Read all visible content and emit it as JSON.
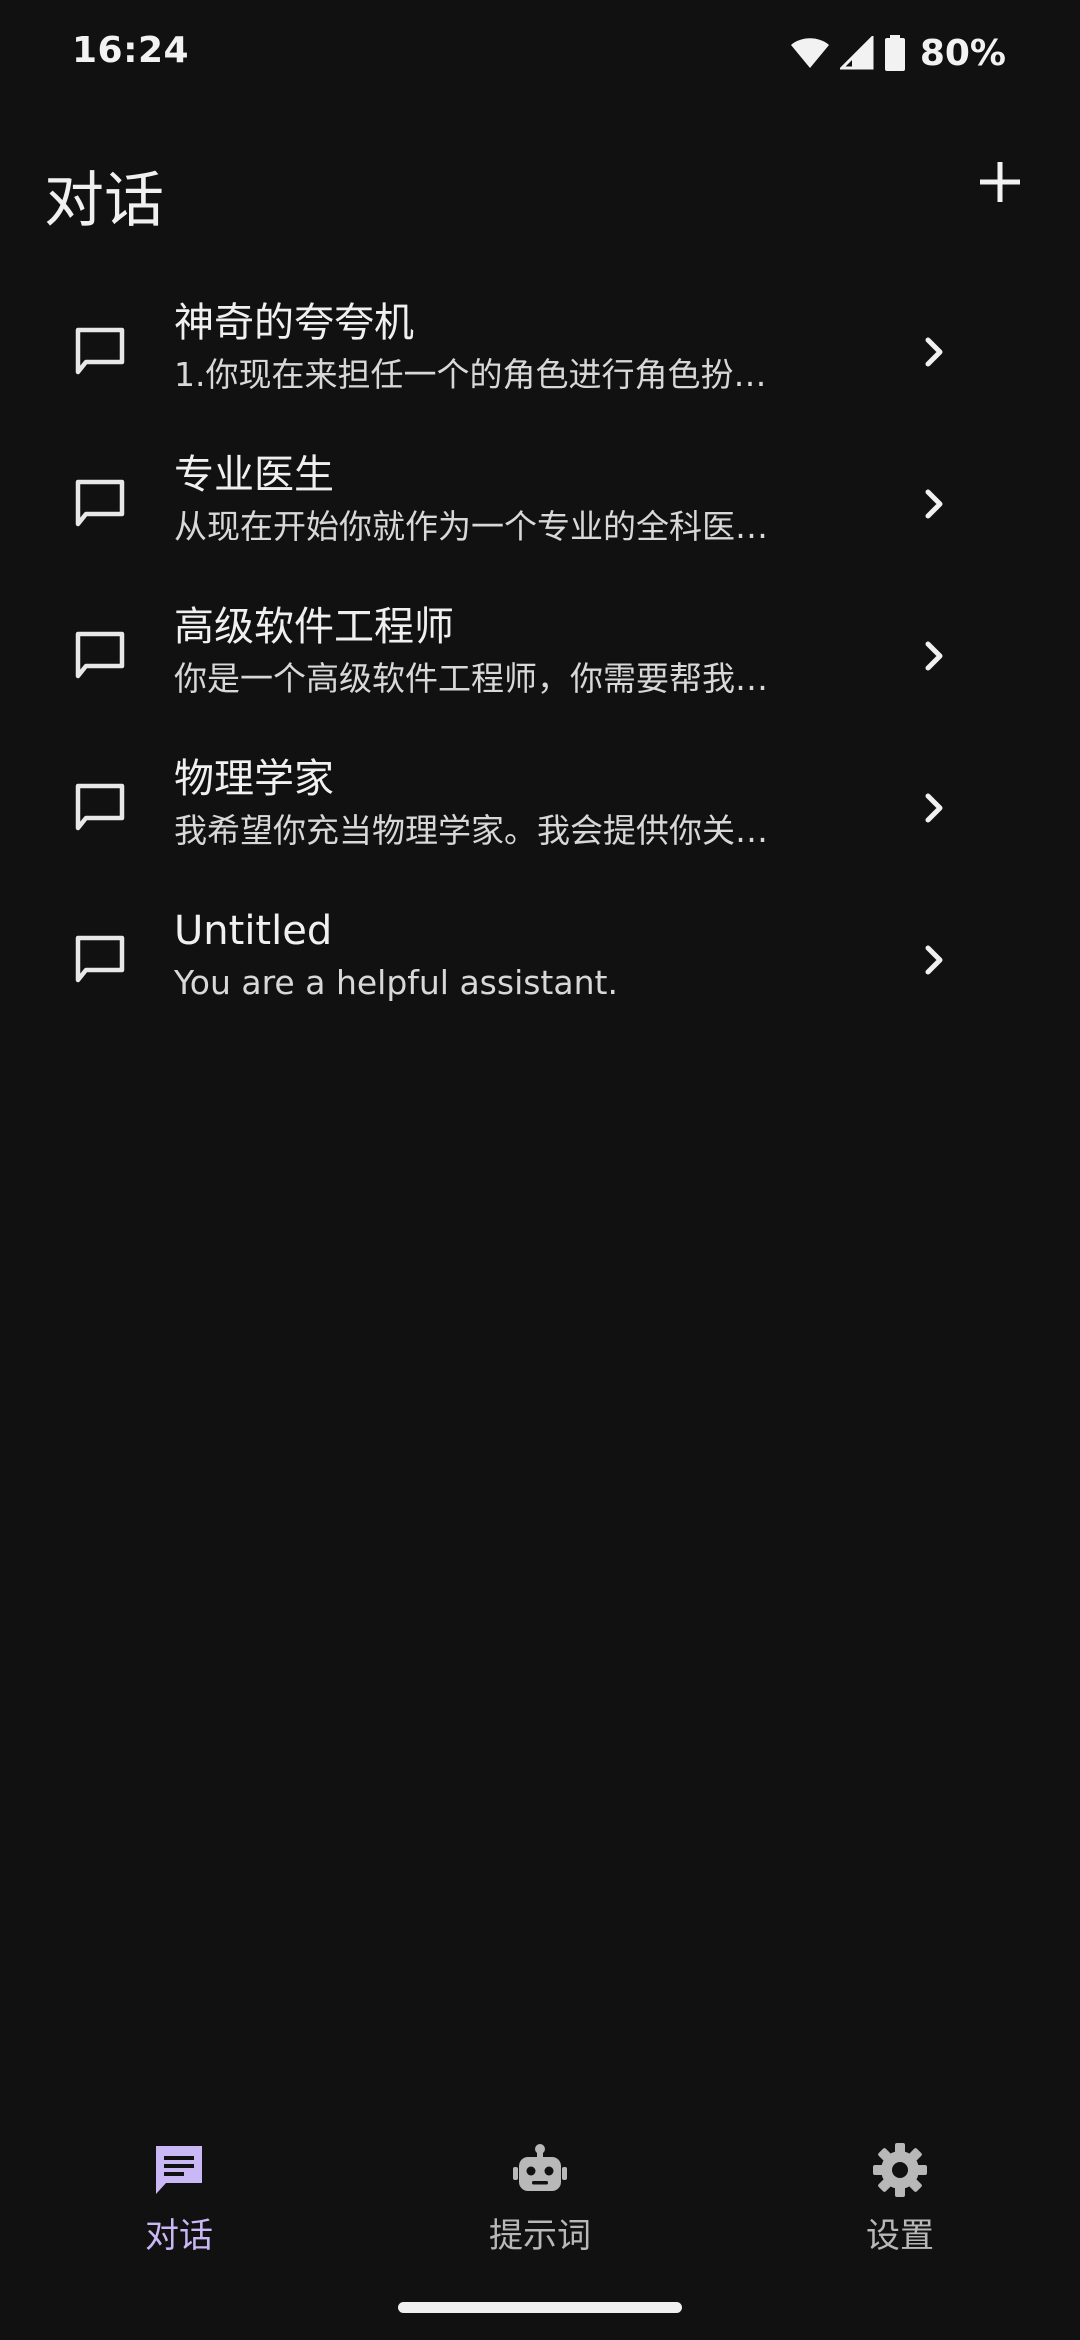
{
  "status_bar": {
    "time": "16:24",
    "battery_percent": "80%",
    "icons": [
      "wifi-icon",
      "cell-signal-icon",
      "battery-icon"
    ]
  },
  "header": {
    "title": "对话",
    "add_icon": "plus-icon"
  },
  "conversations": [
    {
      "title": "神奇的夸夸机",
      "subtitle": "1.你现在来担任一个的角色进行角色扮…"
    },
    {
      "title": "专业医生",
      "subtitle": "从现在开始你就作为一个专业的全科医…"
    },
    {
      "title": "高级软件工程师",
      "subtitle": "你是一个高级软件工程师，你需要帮我…"
    },
    {
      "title": "物理学家",
      "subtitle": "我希望你充当物理学家。我会提供你关…"
    },
    {
      "title": "Untitled",
      "subtitle": "You are a helpful assistant."
    }
  ],
  "bottom_nav": {
    "items": [
      {
        "label": "对话",
        "icon": "chat-icon",
        "active": true
      },
      {
        "label": "提示词",
        "icon": "robot-icon",
        "active": false
      },
      {
        "label": "设置",
        "icon": "gear-icon",
        "active": false
      }
    ]
  },
  "colors": {
    "background": "#111111",
    "text": "#f0f0f0",
    "accent": "#c9b8f5",
    "inactive": "#b8b8b8"
  }
}
